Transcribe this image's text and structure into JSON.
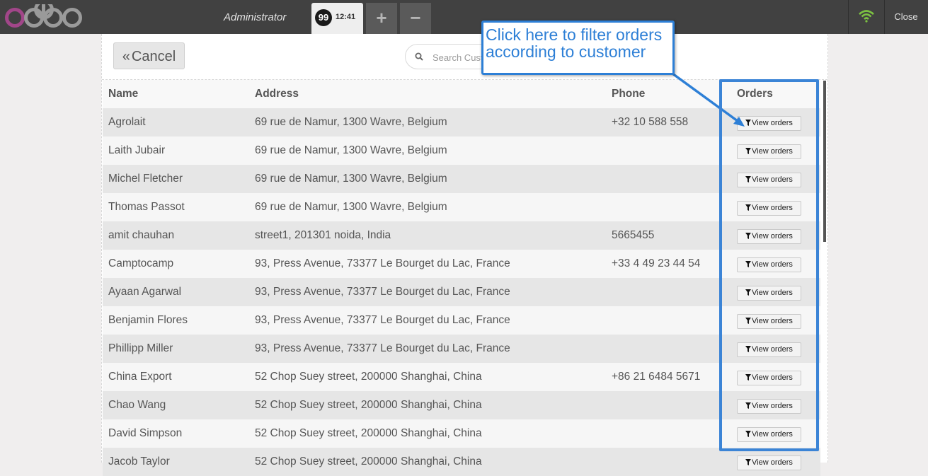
{
  "header": {
    "logo_text": "odoo",
    "user_name": "Administrator",
    "order_tab": {
      "sequence": "99",
      "time": "12:41"
    },
    "add_order_icon": "plus-icon",
    "remove_order_icon": "minus-icon",
    "wifi_icon": "wifi-icon",
    "close_label": "Close"
  },
  "screen": {
    "cancel_label": "Cancel",
    "search_placeholder": "Search Customers"
  },
  "table": {
    "columns": [
      "Name",
      "Address",
      "Phone",
      "Orders"
    ],
    "view_orders_label": "View orders",
    "rows": [
      {
        "name": "Agrolait",
        "address": "69 rue de Namur, 1300 Wavre, Belgium",
        "phone": "+32 10 588 558"
      },
      {
        "name": "Laith Jubair",
        "address": "69 rue de Namur, 1300 Wavre, Belgium",
        "phone": ""
      },
      {
        "name": "Michel Fletcher",
        "address": "69 rue de Namur, 1300 Wavre, Belgium",
        "phone": ""
      },
      {
        "name": "Thomas Passot",
        "address": "69 rue de Namur, 1300 Wavre, Belgium",
        "phone": ""
      },
      {
        "name": "amit chauhan",
        "address": "street1, 201301 noida, India",
        "phone": "5665455"
      },
      {
        "name": "Camptocamp",
        "address": "93, Press Avenue, 73377 Le Bourget du Lac, France",
        "phone": "+33 4 49 23 44 54"
      },
      {
        "name": "Ayaan Agarwal",
        "address": "93, Press Avenue, 73377 Le Bourget du Lac, France",
        "phone": ""
      },
      {
        "name": "Benjamin Flores",
        "address": "93, Press Avenue, 73377 Le Bourget du Lac, France",
        "phone": ""
      },
      {
        "name": "Phillipp Miller",
        "address": "93, Press Avenue, 73377 Le Bourget du Lac, France",
        "phone": ""
      },
      {
        "name": "China Export",
        "address": "52 Chop Suey street, 200000 Shanghai, China",
        "phone": "+86 21 6484 5671"
      },
      {
        "name": "Chao Wang",
        "address": "52 Chop Suey street, 200000 Shanghai, China",
        "phone": ""
      },
      {
        "name": "David Simpson",
        "address": "52 Chop Suey street, 200000 Shanghai, China",
        "phone": ""
      },
      {
        "name": "Jacob Taylor",
        "address": "52 Chop Suey street, 200000 Shanghai, China",
        "phone": ""
      }
    ]
  },
  "annotation": {
    "callout_text": "Click here to filter orders according to customer",
    "color": "#2d7fd6"
  },
  "colors": {
    "topbar": "#414141",
    "row_odd": "#e6e6e6",
    "row_even": "#f6f6f6",
    "logo_accent": "#a24689"
  }
}
